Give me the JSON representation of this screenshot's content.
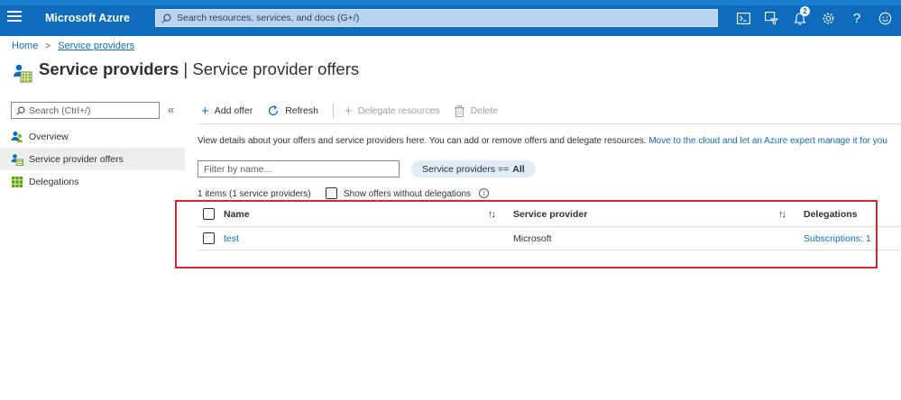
{
  "header": {
    "brand": "Microsoft Azure",
    "search_placeholder": "Search resources, services, and docs (G+/)",
    "notification_count": "2",
    "icons": [
      "cloud-shell-icon",
      "directory-filter-icon",
      "notification-icon",
      "settings-icon",
      "help-icon",
      "feedback-icon"
    ]
  },
  "breadcrumb": {
    "home": "Home",
    "current": "Service providers"
  },
  "title": {
    "main": "Service providers",
    "separator": " | ",
    "sub": "Service provider offers"
  },
  "nav": {
    "search_placeholder": "Search (Ctrl+/)",
    "collapse": "«",
    "items": [
      {
        "label": "Overview",
        "icon": "people-icon"
      },
      {
        "label": "Service provider offers",
        "icon": "service-provider-icon"
      },
      {
        "label": "Delegations",
        "icon": "grid-icon"
      }
    ]
  },
  "toolbar": {
    "add_offer": "Add offer",
    "refresh": "Refresh",
    "delegate_resources": "Delegate resources",
    "delete": "Delete"
  },
  "description": {
    "text": "View details about your offers and service providers here. You can add or remove offers and delegate resources.",
    "link": "Move to the cloud and let an Azure expert manage it for you"
  },
  "filter": {
    "placeholder": "Filter by name...",
    "pill_label": "Service providers ==",
    "pill_value": "All"
  },
  "summary": {
    "count": "1 items (1 service providers)",
    "show_label": "Show offers without delegations"
  },
  "table": {
    "columns": [
      "Name",
      "Service provider",
      "Delegations"
    ],
    "rows": [
      {
        "name": "test",
        "service_provider": "Microsoft",
        "delegations": "Subscriptions: 1"
      }
    ]
  },
  "colors": {
    "azure_blue": "#0f6cbd",
    "highlight_red": "#d9262e"
  }
}
